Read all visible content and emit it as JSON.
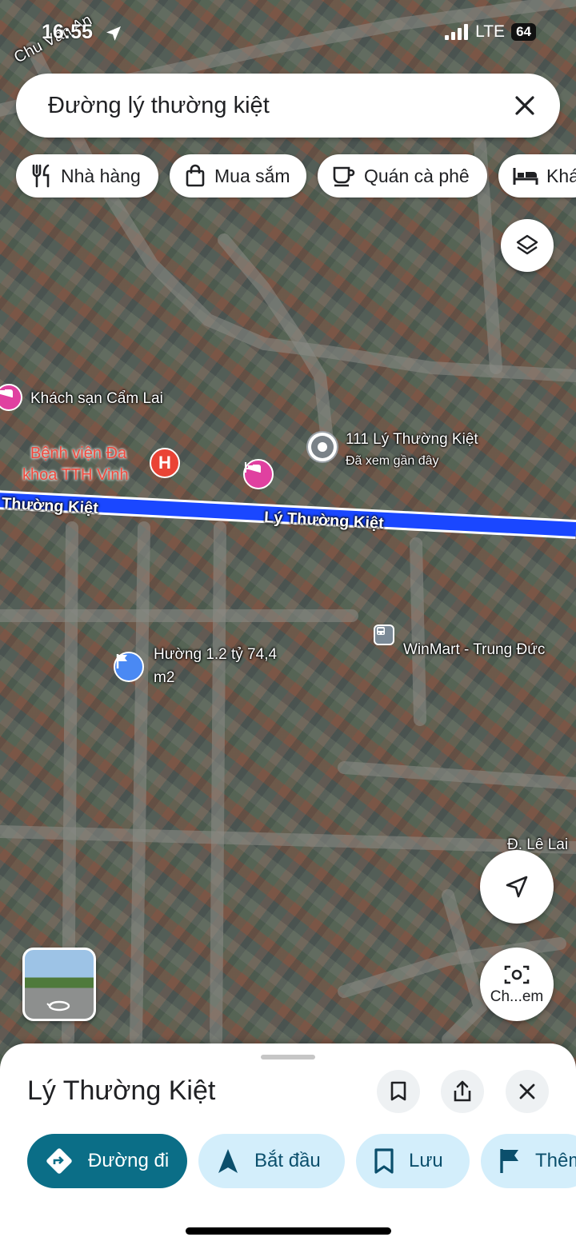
{
  "status_bar": {
    "time": "16:55",
    "network": "LTE",
    "battery": "64"
  },
  "search": {
    "query": "Đường lý thường kiệt"
  },
  "chips": [
    {
      "label": "Nhà hàng",
      "icon": "fork-knife-icon"
    },
    {
      "label": "Mua sắm",
      "icon": "shopping-bag-icon"
    },
    {
      "label": "Quán cà phê",
      "icon": "coffee-cup-icon"
    },
    {
      "label": "Khác",
      "icon": "bed-icon"
    }
  ],
  "map": {
    "labels": {
      "chu_van_an": "Chu Văn An",
      "khach_san": "Khách sạn Cẩm Lai",
      "benh_vien_1": "Bệnh viện Đa",
      "benh_vien_2": "khoa TTH Vinh",
      "pin_title": "111 Lý Thường Kiệt",
      "pin_subtitle": "Đã xem gần đây",
      "street_left": "Thường Kiệt",
      "street_main": "Lý Thường Kiệt",
      "huong_1": "Hường 1.2 tỷ 74,4",
      "huong_2": "m2",
      "winmart": "WinMart - Trung Đức",
      "le_lai": "Đ. Lê Lai",
      "explore": "Ch...em"
    },
    "route_color": "#1a47ff"
  },
  "sheet": {
    "title": "Lý Thường Kiệt",
    "actions": [
      {
        "label": "Đường đi",
        "icon": "directions-icon"
      },
      {
        "label": "Bắt đầu",
        "icon": "navigation-arrow-icon"
      },
      {
        "label": "Lưu",
        "icon": "bookmark-icon"
      },
      {
        "label": "Thêm",
        "icon": "flag-icon"
      }
    ]
  }
}
